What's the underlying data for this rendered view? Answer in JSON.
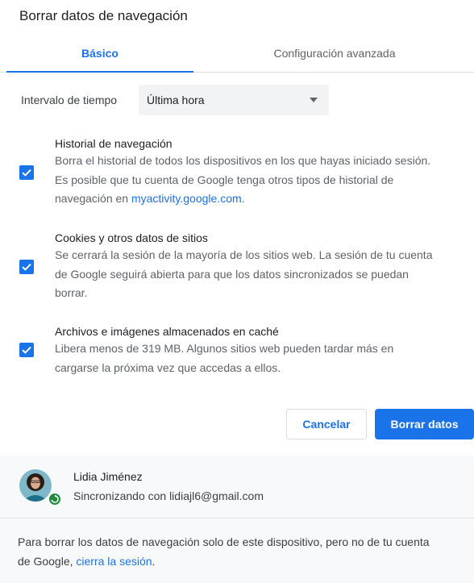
{
  "dialog": {
    "title": "Borrar datos de navegación"
  },
  "tabs": [
    {
      "label": "Básico",
      "active": true
    },
    {
      "label": "Configuración avanzada",
      "active": false
    }
  ],
  "time_range": {
    "label": "Intervalo de tiempo",
    "selected": "Última hora"
  },
  "options": [
    {
      "title": "Historial de navegación",
      "desc_line1": "Borra el historial de todos los dispositivos en los que hayas iniciado sesión.",
      "desc_line2": "Es posible que tu cuenta de Google tenga otros tipos de historial de",
      "desc_line3_prefix": "navegación en ",
      "desc_link": "myactivity.google.com",
      "desc_line3_suffix": ".",
      "checked": true
    },
    {
      "title": "Cookies y otros datos de sitios",
      "desc_line1": "Se cerrará la sesión de la mayoría de los sitios web. La sesión de tu cuenta",
      "desc_line2": "de Google seguirá abierta para que los datos sincronizados se puedan",
      "desc_line3": "borrar.",
      "checked": true
    },
    {
      "title": "Archivos e imágenes almacenados en caché",
      "desc_line1": "Libera menos de 319 MB. Algunos sitios web pueden tardar más en",
      "desc_line2": "cargarse la próxima vez que accedas a ellos.",
      "checked": true
    }
  ],
  "buttons": {
    "cancel": "Cancelar",
    "clear": "Borrar datos"
  },
  "account": {
    "name": "Lidia Jiménez",
    "sync_status": "Sincronizando con lidiajl6@gmail.com"
  },
  "signout_note": {
    "line1": "Para borrar los datos de navegación solo de este dispositivo, pero no de tu cuenta",
    "line2_prefix": "de Google, ",
    "link": "cierra la sesión",
    "line2_suffix": "."
  },
  "colors": {
    "accent": "#1a73e8",
    "sync_badge": "#1e8e3e"
  },
  "icons": [
    "check-icon",
    "dropdown-caret-icon",
    "sync-icon",
    "avatar"
  ]
}
